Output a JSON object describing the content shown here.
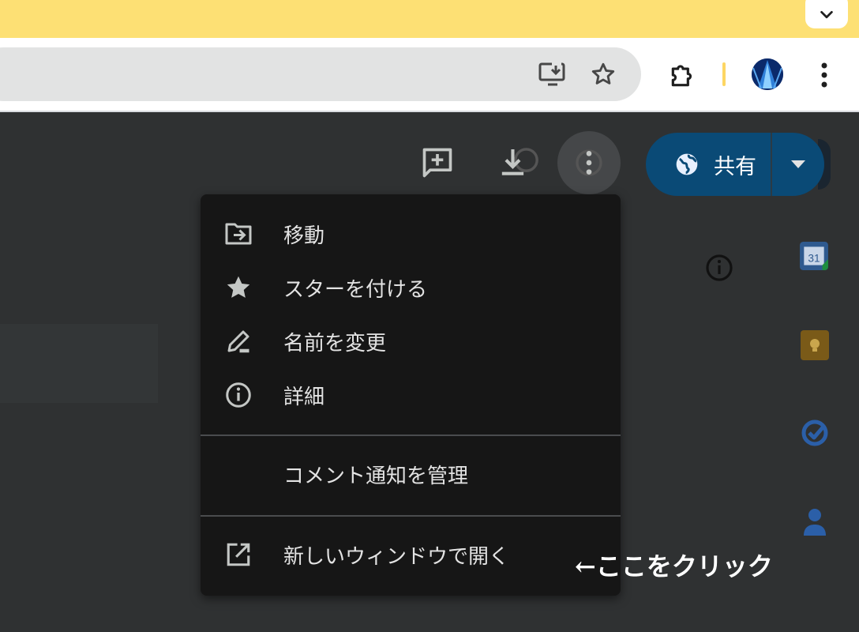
{
  "browser": {
    "icons": {
      "tab_search": "chevron-down-icon",
      "install": "install-app-icon",
      "bookmark": "star-outline-icon",
      "extensions": "puzzle-icon",
      "profile": "avatar",
      "menu": "kebab-menu-icon"
    },
    "colors": {
      "titlebar": "#fde074",
      "omnibox": "#e2e3e3"
    }
  },
  "header": {
    "icons": [
      "add-comment-icon",
      "download-icon",
      "more-vert-icon"
    ],
    "share": {
      "label": "共有",
      "icon": "globe-icon",
      "dropdown_icon": "caret-down-icon",
      "color": "#0a4a76"
    }
  },
  "menu": {
    "items": [
      {
        "label": "移動",
        "icon": "move-to-folder-icon"
      },
      {
        "label": "スターを付ける",
        "icon": "star-icon"
      },
      {
        "label": "名前を変更",
        "icon": "edit-pencil-icon"
      },
      {
        "label": "詳細",
        "icon": "info-icon"
      },
      {
        "label": "コメント通知を管理",
        "icon": ""
      },
      {
        "label": "新しいウィンドウで開く",
        "icon": "open-in-new-icon"
      }
    ]
  },
  "side_panel": {
    "icons": [
      "calendar-icon",
      "keep-icon",
      "tasks-icon",
      "contacts-icon"
    ],
    "calendar_day": "31"
  },
  "annotation": {
    "text": "←ここをクリック"
  }
}
